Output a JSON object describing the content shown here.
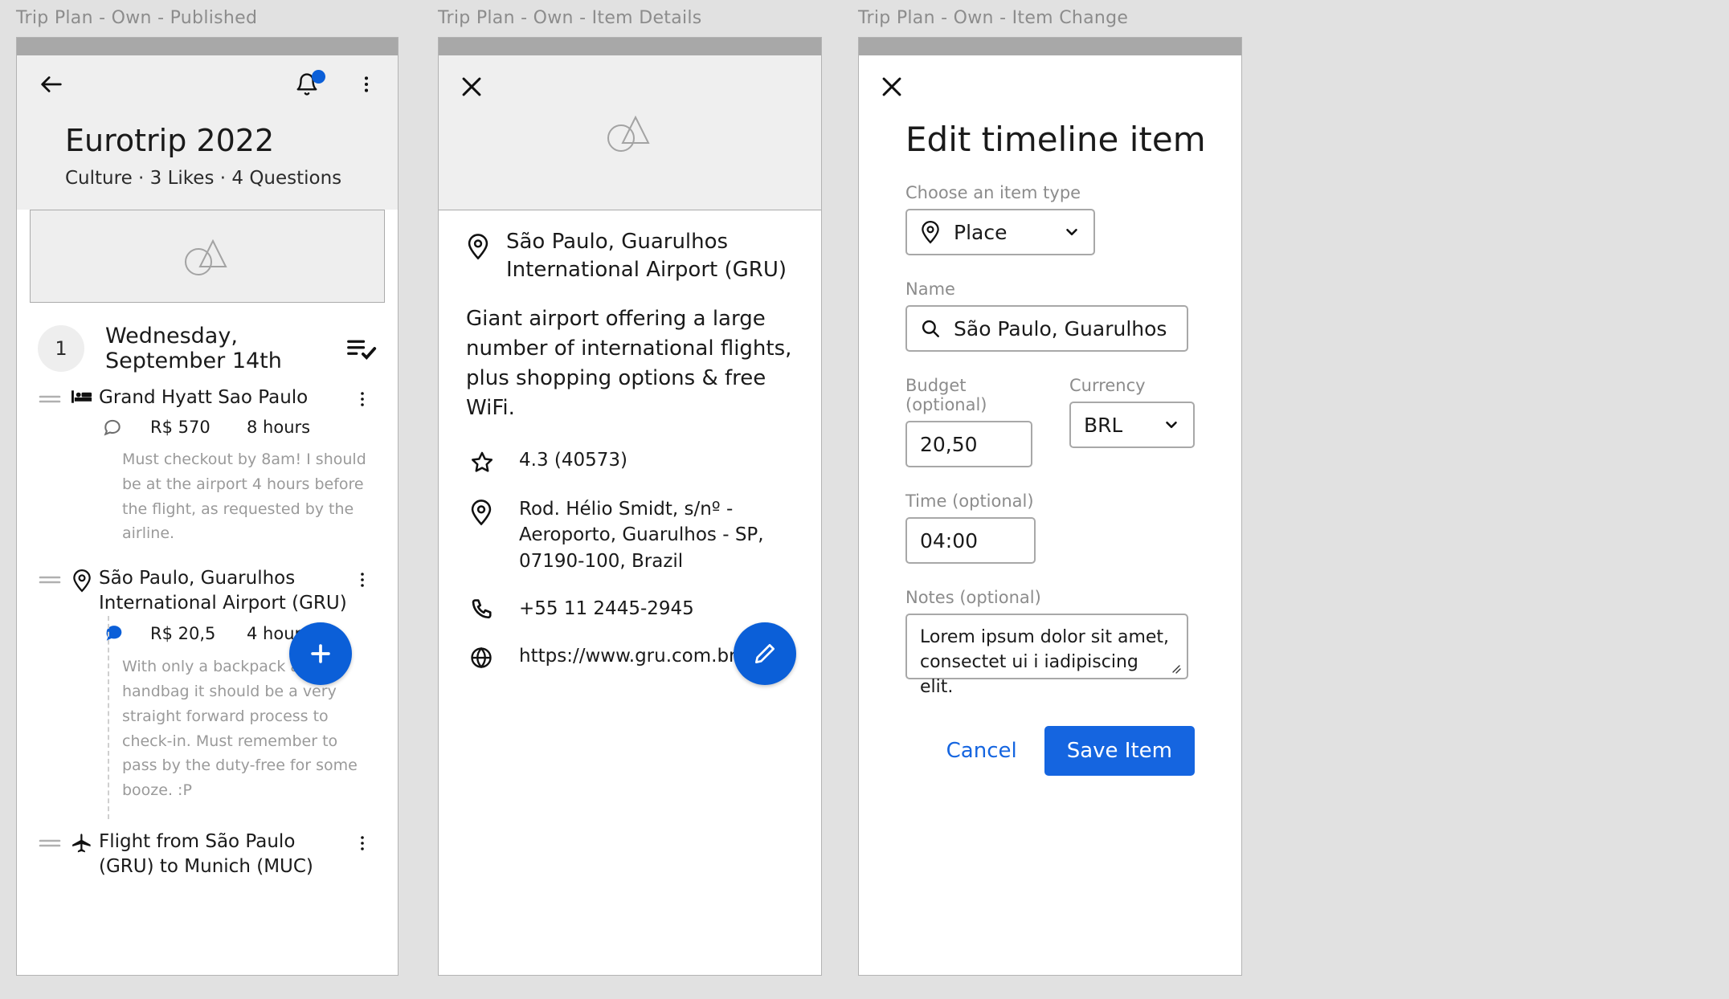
{
  "frames": [
    {
      "title": "Trip Plan - Own - Published"
    },
    {
      "title": "Trip Plan - Own - Item Details"
    },
    {
      "title": "Trip Plan - Own - Item Change"
    }
  ],
  "colors": {
    "accent": "#0b5fd8",
    "link": "#1565e0",
    "muted": "#9a9a9a",
    "border": "#a8a8a8"
  },
  "panel1": {
    "back_icon": "arrow-left-icon",
    "notification_icon": "bell-icon",
    "overflow_icon": "kebab-menu-icon",
    "trip_title": "Eurotrip 2022",
    "trip_meta": "Culture · 3 Likes · 4 Questions",
    "hero_placeholder_icon": "image-placeholder-icon",
    "day": {
      "number": "1",
      "label": "Wednesday, September 14th",
      "checklist_icon": "playlist-check-icon"
    },
    "items": [
      {
        "icon": "hotel-bed-icon",
        "name": "Grand Hyatt Sao Paulo",
        "comment_icon": "comment-outline-icon",
        "price": "R$ 570",
        "duration": "8 hours",
        "note": "Must checkout by 8am! I should be at the airport 4 hours before the flight, as requested by the airline."
      },
      {
        "icon": "map-pin-icon",
        "name": "São Paulo, Guarulhos International Airport (GRU)",
        "comment_icon": "comment-filled-icon",
        "price": "R$ 20,5",
        "duration": "4 hours",
        "note": "With only a backpack and a handbag it should be a very straight forward process to check-in. Must remember to pass by the duty-free for some booze. :P"
      },
      {
        "icon": "airplane-icon",
        "name": "Flight from São Paulo (GRU) to Munich (MUC)"
      }
    ],
    "fab_icon": "plus-icon"
  },
  "panel2": {
    "close_icon": "close-icon",
    "hero_placeholder_icon": "image-placeholder-icon",
    "title_icon": "map-pin-icon",
    "title": "São Paulo, Guarulhos International Airport (GRU)",
    "description": "Giant airport offering a large number of international flights, plus shopping options & free WiFi.",
    "details": [
      {
        "icon": "star-icon",
        "text": "4.3 (40573)"
      },
      {
        "icon": "map-pin-icon",
        "text": "Rod. Hélio Smidt, s/nº - Aeroporto, Guarulhos - SP, 07190-100, Brazil"
      },
      {
        "icon": "phone-icon",
        "text": "+55 11 2445-2945"
      },
      {
        "icon": "globe-icon",
        "text": "https://www.gru.com.br/pt"
      }
    ],
    "fab_icon": "pencil-icon"
  },
  "panel3": {
    "close_icon": "close-icon",
    "title": "Edit timeline item",
    "fields": {
      "item_type": {
        "label": "Choose an item type",
        "icon": "map-pin-icon",
        "value": "Place",
        "chevron_icon": "chevron-down-icon"
      },
      "name": {
        "label": "Name",
        "icon": "search-icon",
        "value": "São Paulo, Guarulhos Internatio…"
      },
      "budget": {
        "label": "Budget (optional)",
        "value": "20,50"
      },
      "currency": {
        "label": "Currency",
        "value": "BRL",
        "chevron_icon": "chevron-down-icon"
      },
      "time": {
        "label": "Time (optional)",
        "value": "04:00"
      },
      "notes": {
        "label": "Notes (optional)",
        "value": "Lorem ipsum dolor sit amet, consectet ui i iadipiscing elit."
      }
    },
    "cancel_label": "Cancel",
    "save_label": "Save Item"
  }
}
